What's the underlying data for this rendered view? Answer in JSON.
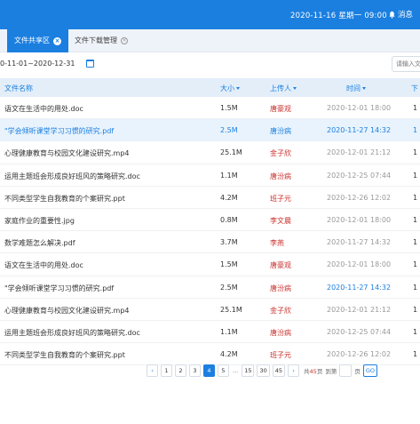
{
  "header": {
    "date": "2020-11-16",
    "greeting": "星期一",
    "time": "09:00",
    "message_label": "消息",
    "icon": "bell-icon"
  },
  "tabs": [
    {
      "label": "文件共享区",
      "active": true
    },
    {
      "label": "文件下载管理",
      "active": false
    }
  ],
  "filter": {
    "date_range": "0-11-01~2020-12-31",
    "search_placeholder": "请输入文件"
  },
  "table": {
    "columns": [
      "文件名称",
      "大小",
      "上传人",
      "时间",
      "下"
    ],
    "rows": [
      {
        "name": "语文在生活中的用处.doc",
        "size": "1.5M",
        "uploader": "唐豪观",
        "time": "2020-12-01 18:00",
        "dl": "1"
      },
      {
        "name": "\"学会倾听课堂学习习惯的研究.pdf",
        "size": "2.5M",
        "uploader": "唐汾病",
        "time": "2020-11-27 14:32",
        "dl": "1"
      },
      {
        "name": "心理健康教育与校园文化建设研究.mp4",
        "size": "25.1M",
        "uploader": "金子欣",
        "time": "2020-12-01 21:12",
        "dl": "1"
      },
      {
        "name": "运用主题班会形成良好班风的策略研究.doc",
        "size": "1.1M",
        "uploader": "唐汾病",
        "time": "2020-12-25 07:44",
        "dl": "1"
      },
      {
        "name": "不同类型学生自我教育的个案研究.ppt",
        "size": "4.2M",
        "uploader": "班子元",
        "time": "2020-12-26 12:02",
        "dl": "1"
      },
      {
        "name": "家庭作业的重要性.jpg",
        "size": "0.8M",
        "uploader": "李文晨",
        "time": "2020-12-01 18:00",
        "dl": "1"
      },
      {
        "name": "数学难题怎么解决.pdf",
        "size": "3.7M",
        "uploader": "李燕",
        "time": "2020-11-27 14:32",
        "dl": "1"
      },
      {
        "name": "语文在生活中的用处.doc",
        "size": "1.5M",
        "uploader": "唐豪观",
        "time": "2020-12-01 18:00",
        "dl": "1"
      },
      {
        "name": "\"学会倾听课堂学习习惯的研究.pdf",
        "size": "2.5M",
        "uploader": "唐汾病",
        "time": "2020-11-27 14:32",
        "dl": "1"
      },
      {
        "name": "心理健康教育与校园文化建设研究.mp4",
        "size": "25.1M",
        "uploader": "金子欣",
        "time": "2020-12-01 21:12",
        "dl": "1"
      },
      {
        "name": "运用主题班会形成良好班风的策略研究.doc",
        "size": "1.1M",
        "uploader": "唐汾病",
        "time": "2020-12-25 07:44",
        "dl": "1"
      },
      {
        "name": "不同类型学生自我教育的个案研究.ppt",
        "size": "4.2M",
        "uploader": "班子元",
        "time": "2020-12-26 12:02",
        "dl": "1"
      }
    ]
  },
  "pagination": {
    "prev": "‹",
    "pages": [
      "1",
      "2",
      "3",
      "4",
      "5"
    ],
    "current": "4",
    "ellipsis": "...",
    "tail_pages": [
      "15",
      "30",
      "45"
    ],
    "next": "›",
    "total_prefix": "共",
    "total_count": "45",
    "total_suffix": "页",
    "jump_label": "到第",
    "jump_suffix": "页",
    "go_label": "GO"
  }
}
